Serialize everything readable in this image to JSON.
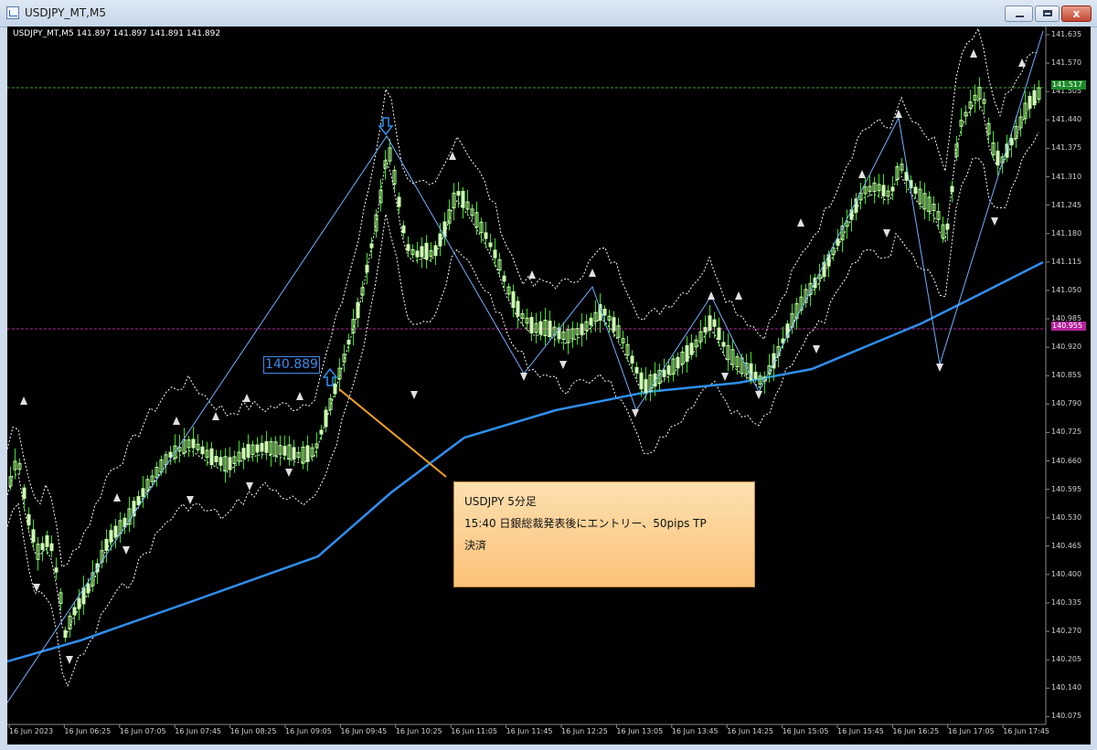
{
  "window": {
    "title": "USDJPY_MT,M5",
    "controls": {
      "minimize": "",
      "maximize": "",
      "close": "x"
    }
  },
  "chart": {
    "symbol_info": "USDJPY_MT,M5  141.897 141.897 141.891 141.892",
    "price_axis": [
      "141.635",
      "141.570",
      "141.505",
      "141.440",
      "141.375",
      "141.310",
      "141.245",
      "141.180",
      "141.115",
      "141.050",
      "140.985",
      "140.920",
      "140.855",
      "140.790",
      "140.725",
      "140.660",
      "140.595",
      "140.530",
      "140.465",
      "140.400",
      "140.335",
      "140.270",
      "140.205",
      "140.140",
      "140.075"
    ],
    "time_axis": [
      "16 Jun 2023",
      "16 Jun 06:25",
      "16 Jun 07:05",
      "16 Jun 07:45",
      "16 Jun 08:25",
      "16 Jun 09:05",
      "16 Jun 09:45",
      "16 Jun 10:25",
      "16 Jun 11:05",
      "16 Jun 11:45",
      "16 Jun 12:25",
      "16 Jun 13:05",
      "16 Jun 13:45",
      "16 Jun 14:25",
      "16 Jun 15:05",
      "16 Jun 15:45",
      "16 Jun 16:25",
      "16 Jun 17:05",
      "16 Jun 17:45"
    ],
    "ask_line_label": "141.517",
    "pink_line_label": "140.955",
    "entry_label": "140.889",
    "annotation": {
      "line1": "USDJPY 5分足",
      "line2": "15:40 日銀総裁発表後にエントリー、50pips TP",
      "line3": "決済"
    },
    "colors": {
      "background": "#000000",
      "candle": "#ccffb0",
      "wick": "#44dd22",
      "moving_average": "#2f8ff0",
      "bands": "#ffffff",
      "zigzag": "#6fb0ff",
      "ask_line": "#3aa32a",
      "pink_line": "#b5229b",
      "annotation_leader": "#f0a020"
    }
  }
}
